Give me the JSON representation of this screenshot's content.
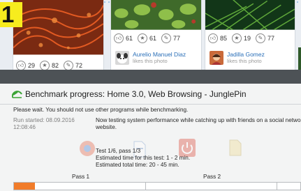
{
  "badge": {
    "number": "1"
  },
  "cards": [
    {
      "likes": "29",
      "stars": "82",
      "comments": "72"
    },
    {
      "likes": "61",
      "stars": "61",
      "comments": "77",
      "liker_name": "Aurelio Manuel Diaz",
      "liker_note": "likes this photo"
    },
    {
      "likes": "85",
      "stars": "19",
      "comments": "77",
      "liker_name": "Jadilla Gomez",
      "liker_note": "likes this photo"
    }
  ],
  "icons": {
    "like": "thumbs-up-icon",
    "star": "star-icon",
    "comment": "comment-icon",
    "benchmark": "benchmark-icon"
  },
  "benchmark": {
    "title": "Benchmark progress: Home 3.0, Web Browsing - JunglePin",
    "warning": "Please wait. You should not use other programs while benchmarking.",
    "run_started_label": "Run started: 08.09.2016",
    "run_started_time": "12:08:46",
    "description_line1": "Now testing system performance while catching up with friends on a social netwo",
    "description_line2": "website.",
    "test_line": "Test 1/6, pass 1/3",
    "estimated_test_time": "Estimated time for this test: 1 - 2 min.",
    "estimated_total_time": "Estimated total time: 20 - 45 min.",
    "pass1_label": "Pass 1",
    "pass2_label": "Pass 2",
    "progress": 0.073
  },
  "colors": {
    "progress": "#f17c2a",
    "accent_green": "#3aa335",
    "badge": "#f7ec1e",
    "link": "#2a6fb8"
  }
}
